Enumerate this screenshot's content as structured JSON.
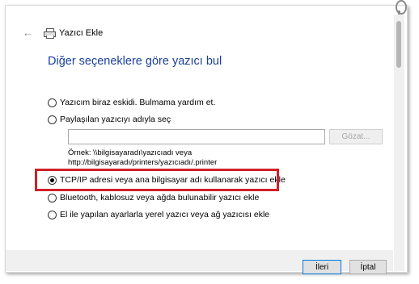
{
  "window": {
    "title": "Yazıcı Ekle"
  },
  "page": {
    "heading": "Diğer seçeneklere göre yazıcı bul"
  },
  "options": [
    {
      "label": "Yazıcım biraz eskidi. Bulmama yardım et.",
      "selected": false
    },
    {
      "label": "Paylaşılan yazıcıyı adıyla seç",
      "selected": false
    },
    {
      "label": "TCP/IP adresi veya ana bilgisayar adı kullanarak yazıcı ekle",
      "selected": true
    },
    {
      "label": "Bluetooth, kablosuz veya ağda bulunabilir yazıcı ekle",
      "selected": false
    },
    {
      "label": "El ile yapılan ayarlarla yerel yazıcı veya ağ yazıcısı ekle",
      "selected": false
    }
  ],
  "shared_printer": {
    "value": "",
    "browse_label": "Gözat...",
    "example_line1": "Örnek: \\\\bilgisayaradı\\yazıcıadı veya",
    "example_line2": "http://bilgisayaradı/printers/yazıcıadı/.printer"
  },
  "buttons": {
    "next": "İleri",
    "cancel": "İptal"
  },
  "colors": {
    "heading": "#1a3f9c",
    "highlight": "#d01f27",
    "primary_border": "#0078d7"
  },
  "icons": {
    "back": "back-arrow-icon",
    "app": "printer-icon"
  }
}
